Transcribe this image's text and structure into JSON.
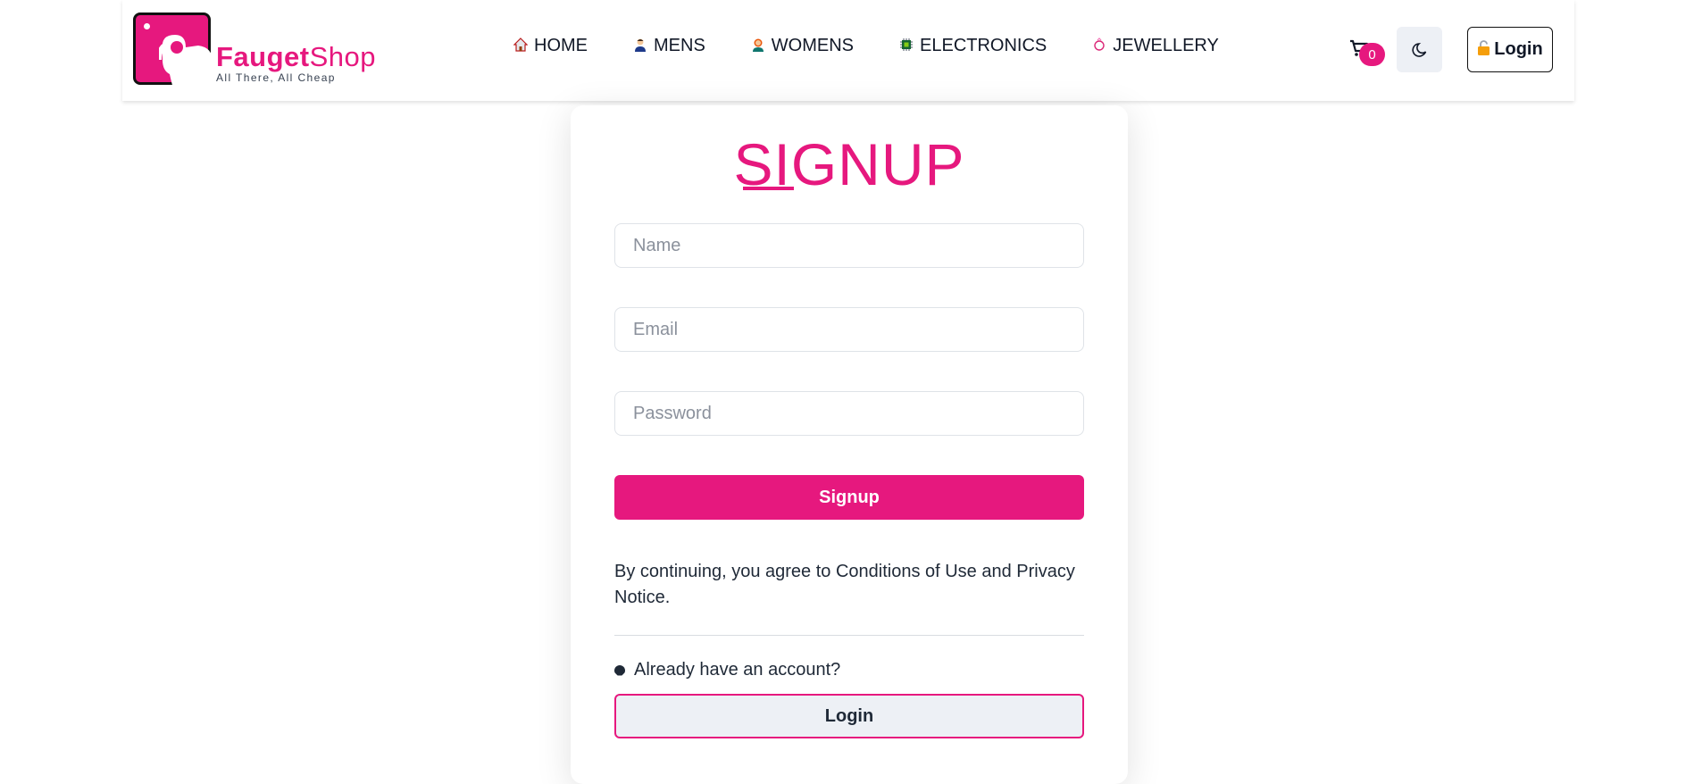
{
  "brand": {
    "name_bold": "Fauget",
    "name_regular": "Shop",
    "tagline": "All There, All Cheap",
    "color": "#e6187e"
  },
  "nav": {
    "links": [
      {
        "label": "HOME",
        "icon": "house-icon",
        "glyph": "🏠"
      },
      {
        "label": "MENS",
        "icon": "man-icon",
        "glyph": "👨"
      },
      {
        "label": "WOMENS",
        "icon": "woman-icon",
        "glyph": "👩"
      },
      {
        "label": "ELECTRONICS",
        "icon": "chip-icon",
        "glyph": "▣"
      },
      {
        "label": "JEWELLERY",
        "icon": "ring-icon",
        "glyph": "◌"
      }
    ],
    "cart_count": "0",
    "login_label": "Login",
    "login_icon": "unlock-icon"
  },
  "form": {
    "title": "SIGNUP",
    "name_placeholder": "Name",
    "email_placeholder": "Email",
    "password_placeholder": "Password",
    "submit_label": "Signup",
    "terms_text": "By continuing, you agree to Conditions of Use and Privacy Notice.",
    "already_text": "Already have an account?",
    "login_label": "Login"
  }
}
